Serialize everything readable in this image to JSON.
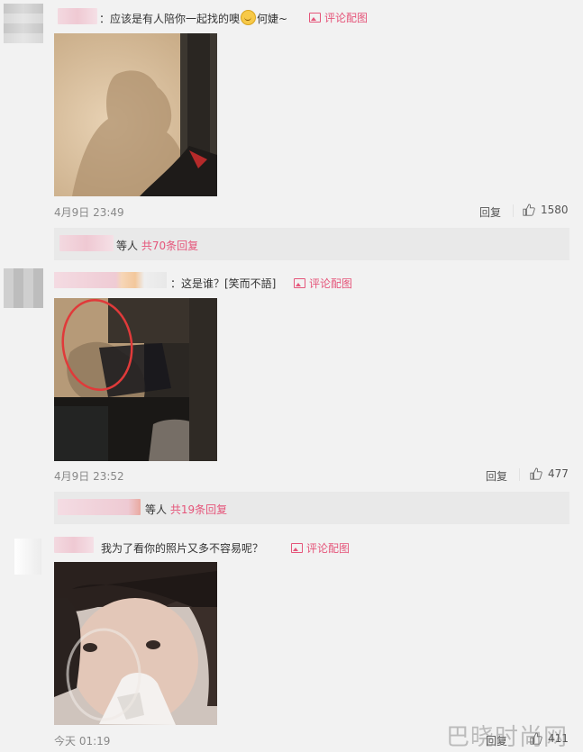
{
  "comments": [
    {
      "text_before_emoji": "：应该是有人陪你一起找的噢",
      "text_after_emoji": "何婕~",
      "pic_link": "评论配图",
      "timestamp": "4月9日 23:49",
      "reply_label": "回复",
      "like_count": "1580",
      "reply_bar_text": "等人",
      "reply_bar_count": "共70条回复"
    },
    {
      "text": "：这是谁？[笑而不語]",
      "pic_link": "评论配图",
      "timestamp": "4月9日 23:52",
      "reply_label": "回复",
      "like_count": "477",
      "reply_bar_text": "等人",
      "reply_bar_count": "共19条回复"
    },
    {
      "text": "我为了看你的照片又多不容易呢？",
      "pic_link": "评论配图",
      "timestamp": "今天 01:19",
      "reply_label": "回复",
      "like_count": "411"
    }
  ],
  "watermark": "巴晓时尚网",
  "colors": {
    "link": "#e5557a",
    "background": "#f2f2f2",
    "reply_bar": "#e9e9e9"
  }
}
